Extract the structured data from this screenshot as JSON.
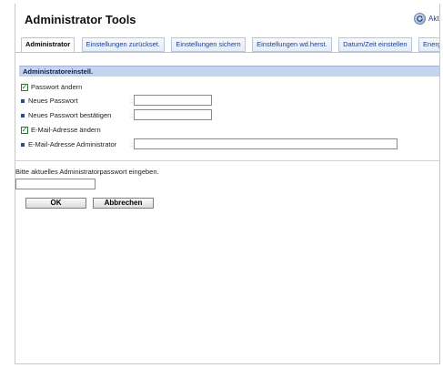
{
  "header": {
    "title": "Administrator Tools",
    "refresh_label": "Aktu"
  },
  "tabs": [
    {
      "label": "Administrator",
      "active": true
    },
    {
      "label": "Einstellungen zurückset."
    },
    {
      "label": "Einstellungen sichern"
    },
    {
      "label": "Einstellungen wd.herst."
    },
    {
      "label": "Datum/Zeit einstellen"
    },
    {
      "label": "Energiesparm"
    }
  ],
  "section": {
    "title": "Administratoreinstell."
  },
  "form": {
    "change_password": {
      "label": "Passwort ändern",
      "checked": true
    },
    "new_password": {
      "label": "Neues Passwort",
      "value": ""
    },
    "confirm_password": {
      "label": "Neues Passwort bestätigen",
      "value": ""
    },
    "change_email": {
      "label": "E-Mail-Adresse ändern",
      "checked": true
    },
    "admin_email": {
      "label": "E-Mail-Adresse Administrator",
      "value": ""
    },
    "colon": ":"
  },
  "auth": {
    "prompt": "Bitte aktuelles Administratorpasswort eingeben.",
    "value": ""
  },
  "buttons": {
    "ok": "OK",
    "cancel": "Abbrechen"
  },
  "colors": {
    "accent": "#c5d4ee",
    "tab_text": "#1c3f8f",
    "checkbox": "#1b7a1b"
  }
}
